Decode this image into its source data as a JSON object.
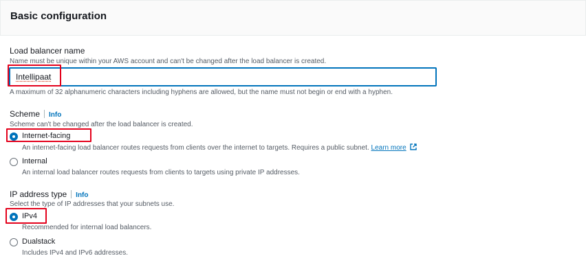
{
  "section": {
    "title": "Basic configuration"
  },
  "lb_name": {
    "label": "Load balancer name",
    "hint": "Name must be unique within your AWS account and can't be changed after the load balancer is created.",
    "value": "Intellipaat",
    "constraint": "A maximum of 32 alphanumeric characters including hyphens are allowed, but the name must not begin or end with a hyphen."
  },
  "scheme": {
    "label": "Scheme",
    "info": "Info",
    "hint": "Scheme can't be changed after the load balancer is created.",
    "options": [
      {
        "label": "Internet-facing",
        "desc": "An internet-facing load balancer routes requests from clients over the internet to targets. Requires a public subnet.",
        "link": "Learn more",
        "checked": true
      },
      {
        "label": "Internal",
        "desc": "An internal load balancer routes requests from clients to targets using private IP addresses.",
        "checked": false
      }
    ]
  },
  "ip_type": {
    "label": "IP address type",
    "info": "Info",
    "hint": "Select the type of IP addresses that your subnets use.",
    "options": [
      {
        "label": "IPv4",
        "desc": "Recommended for internal load balancers.",
        "checked": true
      },
      {
        "label": "Dualstack",
        "desc": "Includes IPv4 and IPv6 addresses.",
        "checked": false
      }
    ]
  },
  "colors": {
    "accent": "#0073bb",
    "highlight": "#e3001b"
  },
  "icons": {
    "external": "external-link-icon"
  }
}
